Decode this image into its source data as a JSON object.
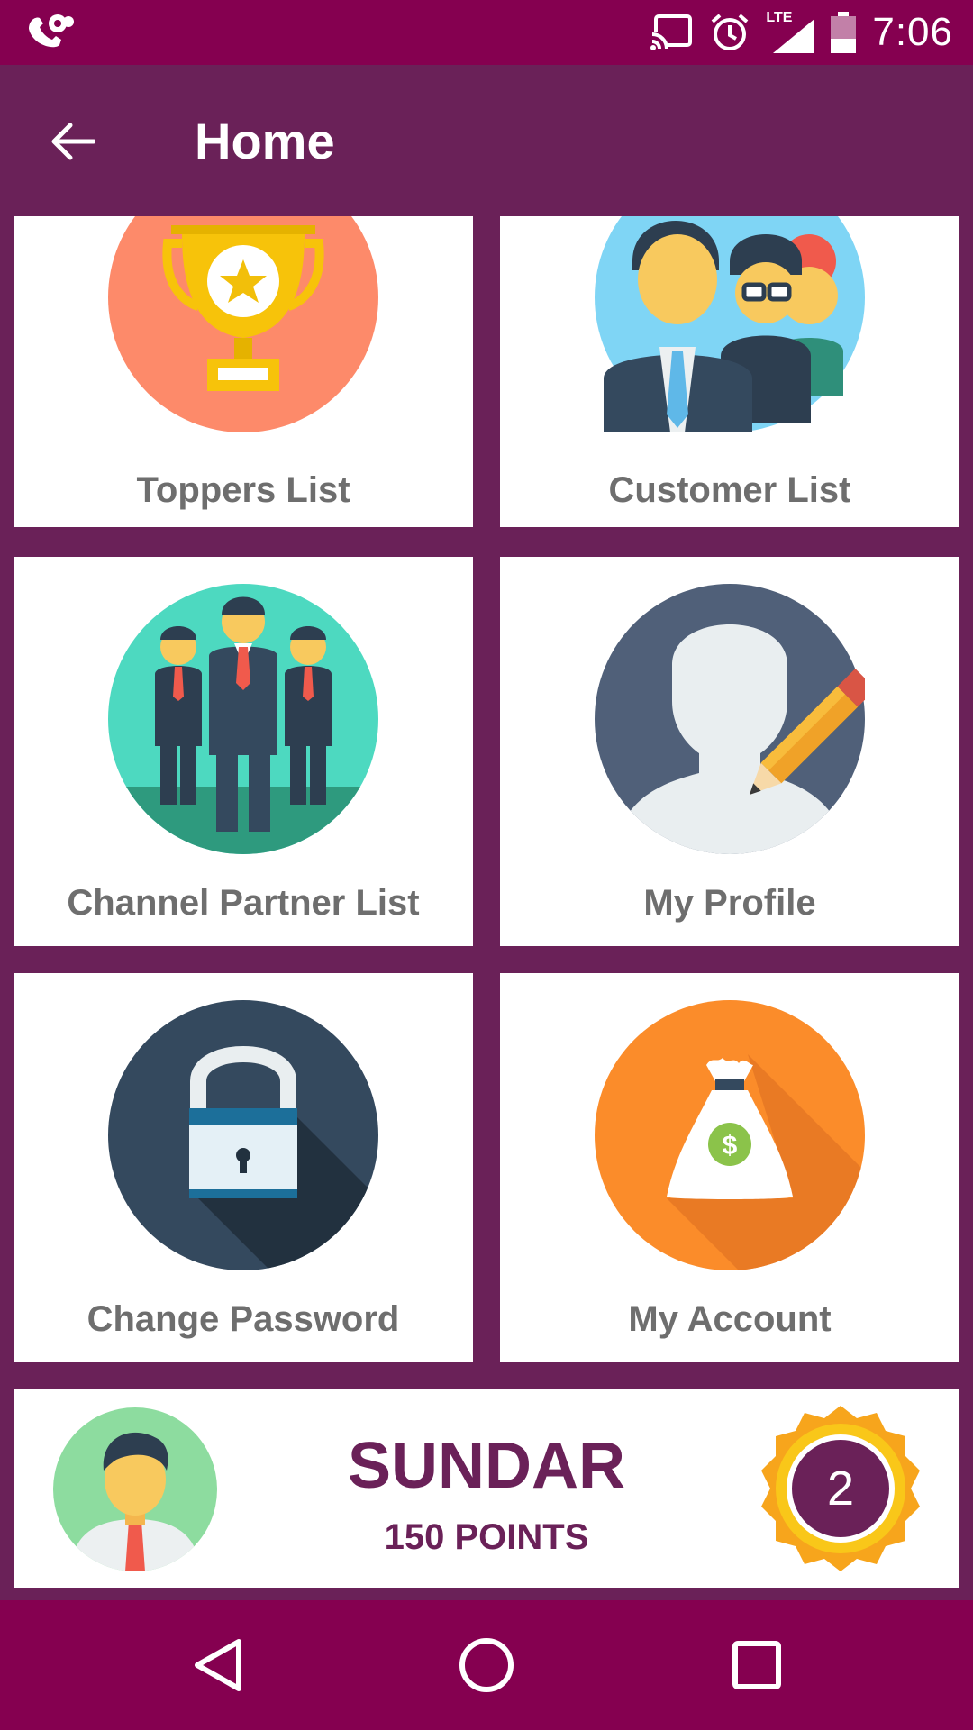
{
  "status_bar": {
    "time": "7:06",
    "icons": [
      "voicemail-phone-icon",
      "cast-icon",
      "alarm-icon",
      "lte-signal-icon",
      "battery-icon"
    ],
    "network_label": "LTE"
  },
  "app_bar": {
    "title": "Home",
    "back_icon": "arrow-left-icon"
  },
  "menu": [
    {
      "label": "Toppers List",
      "icon": "trophy-icon"
    },
    {
      "label": "Customer List",
      "icon": "people-group-icon"
    },
    {
      "label": "Channel Partner List",
      "icon": "business-team-icon"
    },
    {
      "label": "My Profile",
      "icon": "profile-edit-icon"
    },
    {
      "label": "Change Password",
      "icon": "padlock-icon"
    },
    {
      "label": "My Account",
      "icon": "money-bag-icon"
    }
  ],
  "user": {
    "name": "SUNDAR",
    "points": "150 POINTS",
    "rank": "2",
    "avatar_icon": "user-avatar-icon",
    "badge_icon": "rank-medal-icon"
  },
  "nav_bar": {
    "icons": [
      "back-triangle-icon",
      "home-circle-icon",
      "recents-square-icon"
    ]
  },
  "colors": {
    "primary": "#6a2158",
    "status_bar": "#850050",
    "label_gray": "#6e6e6e"
  }
}
